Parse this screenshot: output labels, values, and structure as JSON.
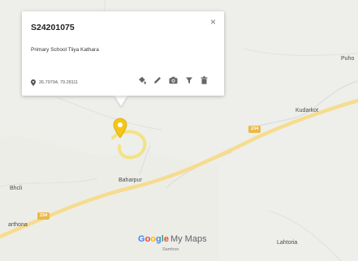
{
  "popup": {
    "title": "S24201075",
    "description": "Primary School Tiiya Kathara",
    "coordinates": "26.79794, 79.28111",
    "close_label": "×",
    "actions": [
      "paint-bucket-icon",
      "pencil-icon",
      "camera-icon",
      "filter-icon",
      "trash-icon"
    ]
  },
  "map": {
    "places": [
      "Puho",
      "Kudarkot",
      "Baharpur",
      "Bhcli",
      "arthona",
      "Lahtoria"
    ],
    "route_shields": [
      "234",
      "234"
    ],
    "marker_color": "#f5c518",
    "road_color": "#f6dc8e"
  },
  "branding": {
    "google": [
      "G",
      "o",
      "o",
      "g",
      "l",
      "e"
    ],
    "product": "My Maps",
    "sub": "Samhon"
  }
}
